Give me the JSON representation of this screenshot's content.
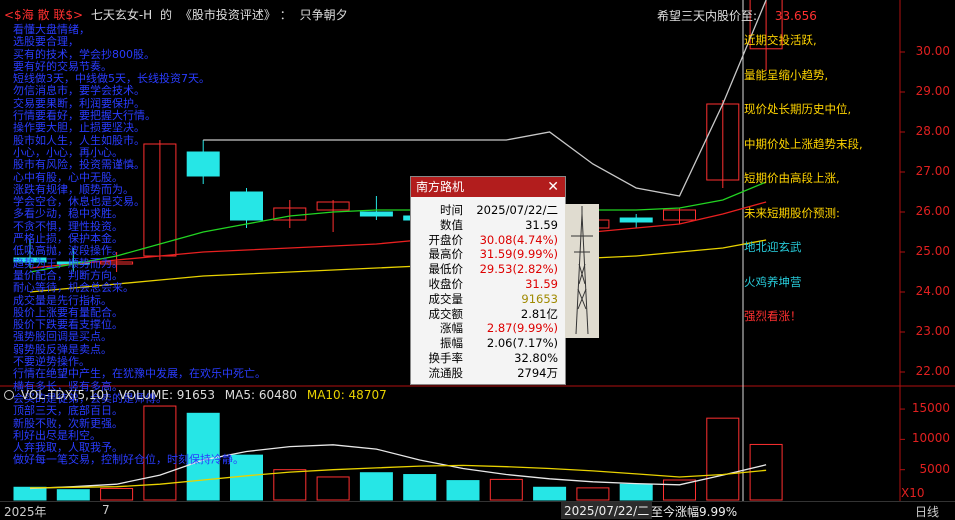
{
  "header": {
    "title_prefix": "<$海 散 联$>",
    "author": "七天玄女-H",
    "connector": "的",
    "book": "《股市投资评述》",
    "colon": "：",
    "tagline": "只争朝夕",
    "target_label": "希望三天内股价至:",
    "target_value": "33.656"
  },
  "left_notes": [
    "看懂大盘情绪，",
    "选股要合理，",
    "买有的技术，学会抄800股。",
    "要有好的交易节奏。",
    "短线做3天，中线做5天，长线投资7天。",
    "勿信消息市，要学会技术。",
    "交易要果断，利润要保护。",
    "行情要看好，要把握大行情。",
    "操作要大胆，止损要坚决。",
    "股市如人生，人生如股市。",
    "小心，小心，再小心。",
    "股市有风险，投资需谨慎。",
    "心中有股，心中无股。",
    "涨跌有规律，顺势而为。",
    "学会空仓，休息也是交易。",
    "多看少动，稳中求胜。",
    "不贪不惧，理性投资。",
    "严格止损，保护本金。",
    "低吸高抛，波段操作。",
    "趋势为王，顺势而为。",
    "量价配合，判断方向。",
    "耐心等待，机会总会来。",
    "成交量是先行指标。",
    "股价上涨要有量配合。",
    "股价下跌要看支撑位。",
    "强势股回调是买点。",
    "弱势股反弹是卖点。",
    "不要逆势操作。",
    "行情在绝望中产生，在犹豫中发展，在欢乐中死亡。",
    "横有多长，竖有多高。",
    "会买的是徒弟，会卖的是师傅。",
    "顶部三天，底部百日。",
    "新股不败，次新更强。",
    "利好出尽是利空。",
    "人弃我取，人取我予。",
    "做好每一笔交易，控制好仓位，时刻保持冷静。"
  ],
  "right_notes": [
    {
      "text": "近期交投活跃,",
      "color": "#ffd400"
    },
    {
      "text": "量能呈缩小趋势,",
      "color": "#ffd400"
    },
    {
      "text": "现价处长期历史中位,",
      "color": "#ffd400"
    },
    {
      "text": "中期价处上涨趋势末段,",
      "color": "#ffd400"
    },
    {
      "text": "短期价由高段上涨,",
      "color": "#ffd400"
    },
    {
      "text": "未来短期股价预测:",
      "color": "#ffd400"
    },
    {
      "text": "地北迎玄武",
      "color": "#27c9d8"
    },
    {
      "text": "火鸡养坤营",
      "color": "#27c9d8"
    },
    {
      "text": "强烈看涨！",
      "color": "#ff3030"
    }
  ],
  "price_axis": [
    "30.00",
    "29.00",
    "28.00",
    "27.00",
    "26.00",
    "25.00",
    "24.00",
    "23.00",
    "22.00"
  ],
  "volume_header": {
    "indicator": "VOL-TDX(5,10)",
    "volume": "VOLUME: 91653",
    "ma5": "MA5: 60480",
    "ma10": "MA10: 48707"
  },
  "volume_axis": [
    "15000",
    "10000",
    "5000"
  ],
  "volume_unit": "X10",
  "bottom_bar": {
    "year": "2025年",
    "month": "7",
    "current_date": "2025/07/22/二",
    "change_label": "至今涨幅9.99%",
    "period": "日线"
  },
  "popup": {
    "title": "南方路机",
    "close": "✕",
    "rows": [
      {
        "label": "时间",
        "value": "2025/07/22/二",
        "cls": ""
      },
      {
        "label": "数值",
        "value": "31.59",
        "cls": ""
      },
      {
        "label": "开盘价",
        "value": "30.08(4.74%)",
        "cls": "red"
      },
      {
        "label": "最高价",
        "value": "31.59(9.99%)",
        "cls": "red"
      },
      {
        "label": "最低价",
        "value": "29.53(2.82%)",
        "cls": "red"
      },
      {
        "label": "收盘价",
        "value": "31.59",
        "cls": "red"
      },
      {
        "label": "成交量",
        "value": "91653",
        "cls": "olive"
      },
      {
        "label": "成交额",
        "value": "2.81亿",
        "cls": ""
      },
      {
        "label": "涨幅",
        "value": "2.87(9.99%)",
        "cls": "red"
      },
      {
        "label": "振幅",
        "value": "2.06(7.17%)",
        "cls": ""
      },
      {
        "label": "换手率",
        "value": "32.80%",
        "cls": ""
      },
      {
        "label": "流通股",
        "value": "2794万",
        "cls": ""
      }
    ]
  },
  "colors": {
    "up": "#ff3030",
    "down": "#26e6e6",
    "ma_white": "#e8e8e8",
    "ma_yellow": "#e8d200",
    "ma_green": "#22d422",
    "ma_red": "#e82020",
    "axis": "#b01010"
  },
  "chart_data": {
    "type": "candlestick",
    "price_range": [
      21.6,
      31.3
    ],
    "volume_range": [
      0,
      16000
    ],
    "candles": [
      {
        "o": 24.85,
        "c": 24.75,
        "h": 25.3,
        "l": 24.6,
        "v": 2100
      },
      {
        "o": 24.75,
        "c": 24.7,
        "h": 25.1,
        "l": 24.5,
        "v": 1700
      },
      {
        "o": 24.7,
        "c": 24.75,
        "h": 25.0,
        "l": 24.5,
        "v": 1900
      },
      {
        "o": 24.9,
        "c": 27.7,
        "h": 27.8,
        "l": 24.8,
        "v": 15500
      },
      {
        "o": 27.5,
        "c": 26.9,
        "h": 27.8,
        "l": 26.7,
        "v": 14300
      },
      {
        "o": 26.5,
        "c": 25.8,
        "h": 26.6,
        "l": 25.6,
        "v": 7400
      },
      {
        "o": 25.8,
        "c": 26.1,
        "h": 26.3,
        "l": 25.6,
        "v": 5000
      },
      {
        "o": 26.05,
        "c": 26.25,
        "h": 26.3,
        "l": 25.5,
        "v": 3800
      },
      {
        "o": 26.0,
        "c": 25.9,
        "h": 26.4,
        "l": 25.8,
        "v": 4500
      },
      {
        "o": 25.9,
        "c": 25.8,
        "h": 26.1,
        "l": 25.7,
        "v": 4200
      },
      {
        "o": 25.7,
        "c": 25.55,
        "h": 26.0,
        "l": 25.2,
        "v": 3200
      },
      {
        "o": 25.75,
        "c": 25.9,
        "h": 26.0,
        "l": 25.6,
        "v": 3400
      },
      {
        "o": 25.75,
        "c": 25.65,
        "h": 25.85,
        "l": 25.5,
        "v": 2100
      },
      {
        "o": 25.6,
        "c": 25.8,
        "h": 25.95,
        "l": 25.5,
        "v": 2000
      },
      {
        "o": 25.85,
        "c": 25.75,
        "h": 25.95,
        "l": 25.6,
        "v": 2600
      },
      {
        "o": 25.8,
        "c": 26.05,
        "h": 26.1,
        "l": 25.7,
        "v": 3300
      },
      {
        "o": 26.8,
        "c": 28.7,
        "h": 28.8,
        "l": 26.6,
        "v": 13500
      },
      {
        "o": 30.08,
        "c": 31.59,
        "h": 31.59,
        "l": 29.53,
        "v": 9165
      }
    ],
    "ma_white": [
      null,
      null,
      null,
      null,
      27.8,
      27.8,
      27.8,
      27.8,
      27.8,
      27.8,
      27.8,
      27.8,
      28.0,
      27.2,
      26.6,
      26.4,
      28.7,
      31.3
    ],
    "ma_green": [
      24.5,
      24.7,
      24.9,
      25.2,
      25.5,
      25.7,
      25.9,
      26.0,
      26.05,
      26.05,
      26.05,
      26.05,
      26.05,
      26.05,
      26.05,
      26.1,
      26.3,
      26.75
    ],
    "ma_red": [
      24.6,
      24.7,
      24.8,
      24.9,
      25.0,
      25.05,
      25.1,
      25.15,
      25.2,
      25.3,
      25.35,
      25.4,
      25.45,
      25.5,
      25.6,
      25.7,
      25.95,
      26.25
    ],
    "ma_yellow": [
      24.0,
      24.1,
      24.2,
      24.3,
      24.4,
      24.45,
      24.5,
      24.55,
      24.6,
      24.65,
      24.7,
      24.75,
      24.8,
      24.85,
      24.9,
      25.0,
      25.1,
      25.3
    ],
    "vol_ma_white": [
      1900,
      2200,
      2600,
      4100,
      6600,
      8000,
      8800,
      9100,
      8400,
      6600,
      5200,
      4200,
      3500,
      3000,
      2700,
      2500,
      4100,
      5800
    ],
    "vol_ma_yellow": [
      2000,
      2100,
      2200,
      2600,
      3300,
      4000,
      4600,
      5000,
      5300,
      5600,
      5700,
      5500,
      5200,
      4800,
      4300,
      3800,
      4200,
      4900
    ]
  }
}
